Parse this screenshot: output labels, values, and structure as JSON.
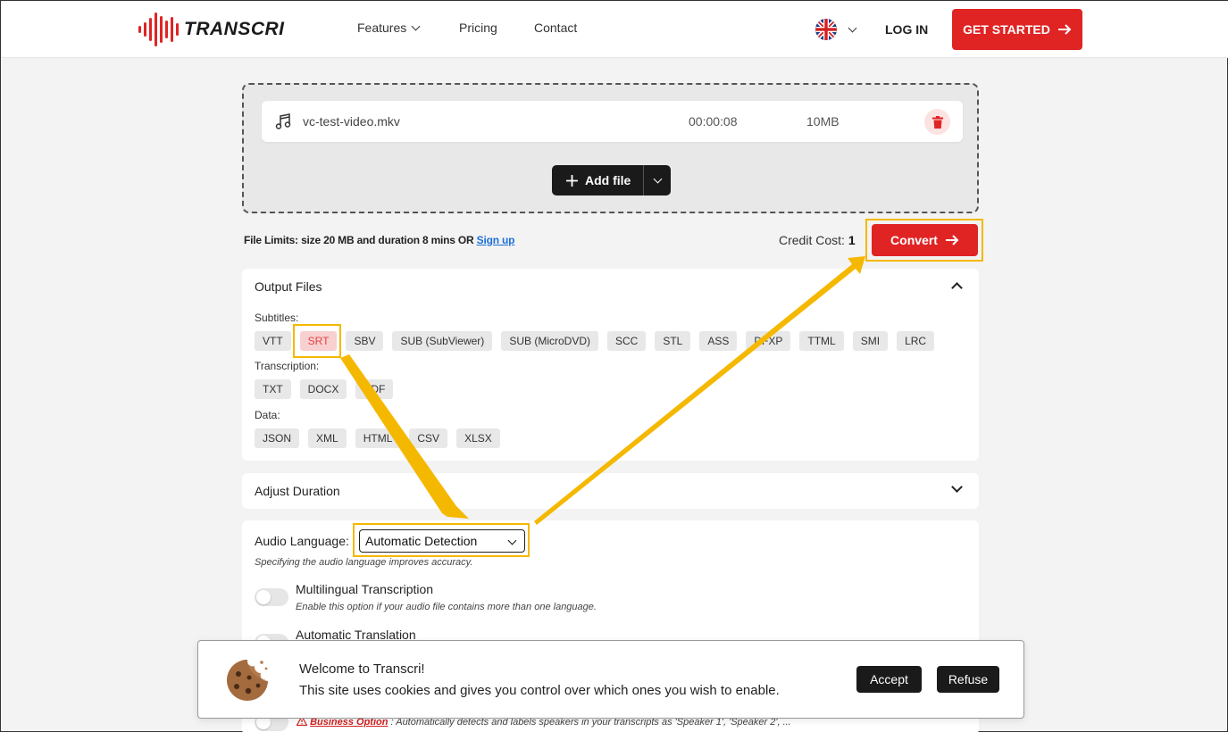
{
  "header": {
    "logo_text": "TRANSCRI",
    "nav": {
      "features": "Features",
      "pricing": "Pricing",
      "contact": "Contact"
    },
    "login": "LOG IN",
    "get_started": "GET STARTED"
  },
  "upload": {
    "file": {
      "name": "vc-test-video.mkv",
      "duration": "00:00:08",
      "size": "10MB"
    },
    "add_file": "Add file"
  },
  "limits": {
    "text": "File Limits: size 20 MB and duration 8 mins OR ",
    "signup": "Sign up",
    "credit_label": "Credit Cost:",
    "credit_value": "1",
    "convert": "Convert"
  },
  "output": {
    "title": "Output Files",
    "subtitles_label": "Subtitles:",
    "subtitles": [
      "VTT",
      "SRT",
      "SBV",
      "SUB (SubViewer)",
      "SUB (MicroDVD)",
      "SCC",
      "STL",
      "ASS",
      "DFXP",
      "TTML",
      "SMI",
      "LRC"
    ],
    "transcription_label": "Transcription:",
    "transcription": [
      "TXT",
      "DOCX",
      "PDF"
    ],
    "data_label": "Data:",
    "data": [
      "JSON",
      "XML",
      "HTML",
      "CSV",
      "XLSX"
    ],
    "selected": "SRT"
  },
  "duration": {
    "title": "Adjust Duration"
  },
  "options": {
    "audio_label": "Audio Language:",
    "audio_value": "Automatic Detection",
    "audio_hint": "Specifying the audio language improves accuracy.",
    "multilingual_title": "Multilingual Transcription",
    "multilingual_hint": "Enable this option if your audio file contains more than one language.",
    "translation_title": "Automatic Translation",
    "business_label": "Business Option",
    "business_text": " : Automatically detects and labels speakers in your transcripts as 'Speaker 1', 'Speaker 2', ..."
  },
  "cookie": {
    "title": "Welcome to Transcri!",
    "text": "This site uses cookies and gives you control over which ones you wish to enable.",
    "accept": "Accept",
    "refuse": "Refuse"
  },
  "colors": {
    "brand_red": "#e02424",
    "highlight": "#f5b800"
  }
}
